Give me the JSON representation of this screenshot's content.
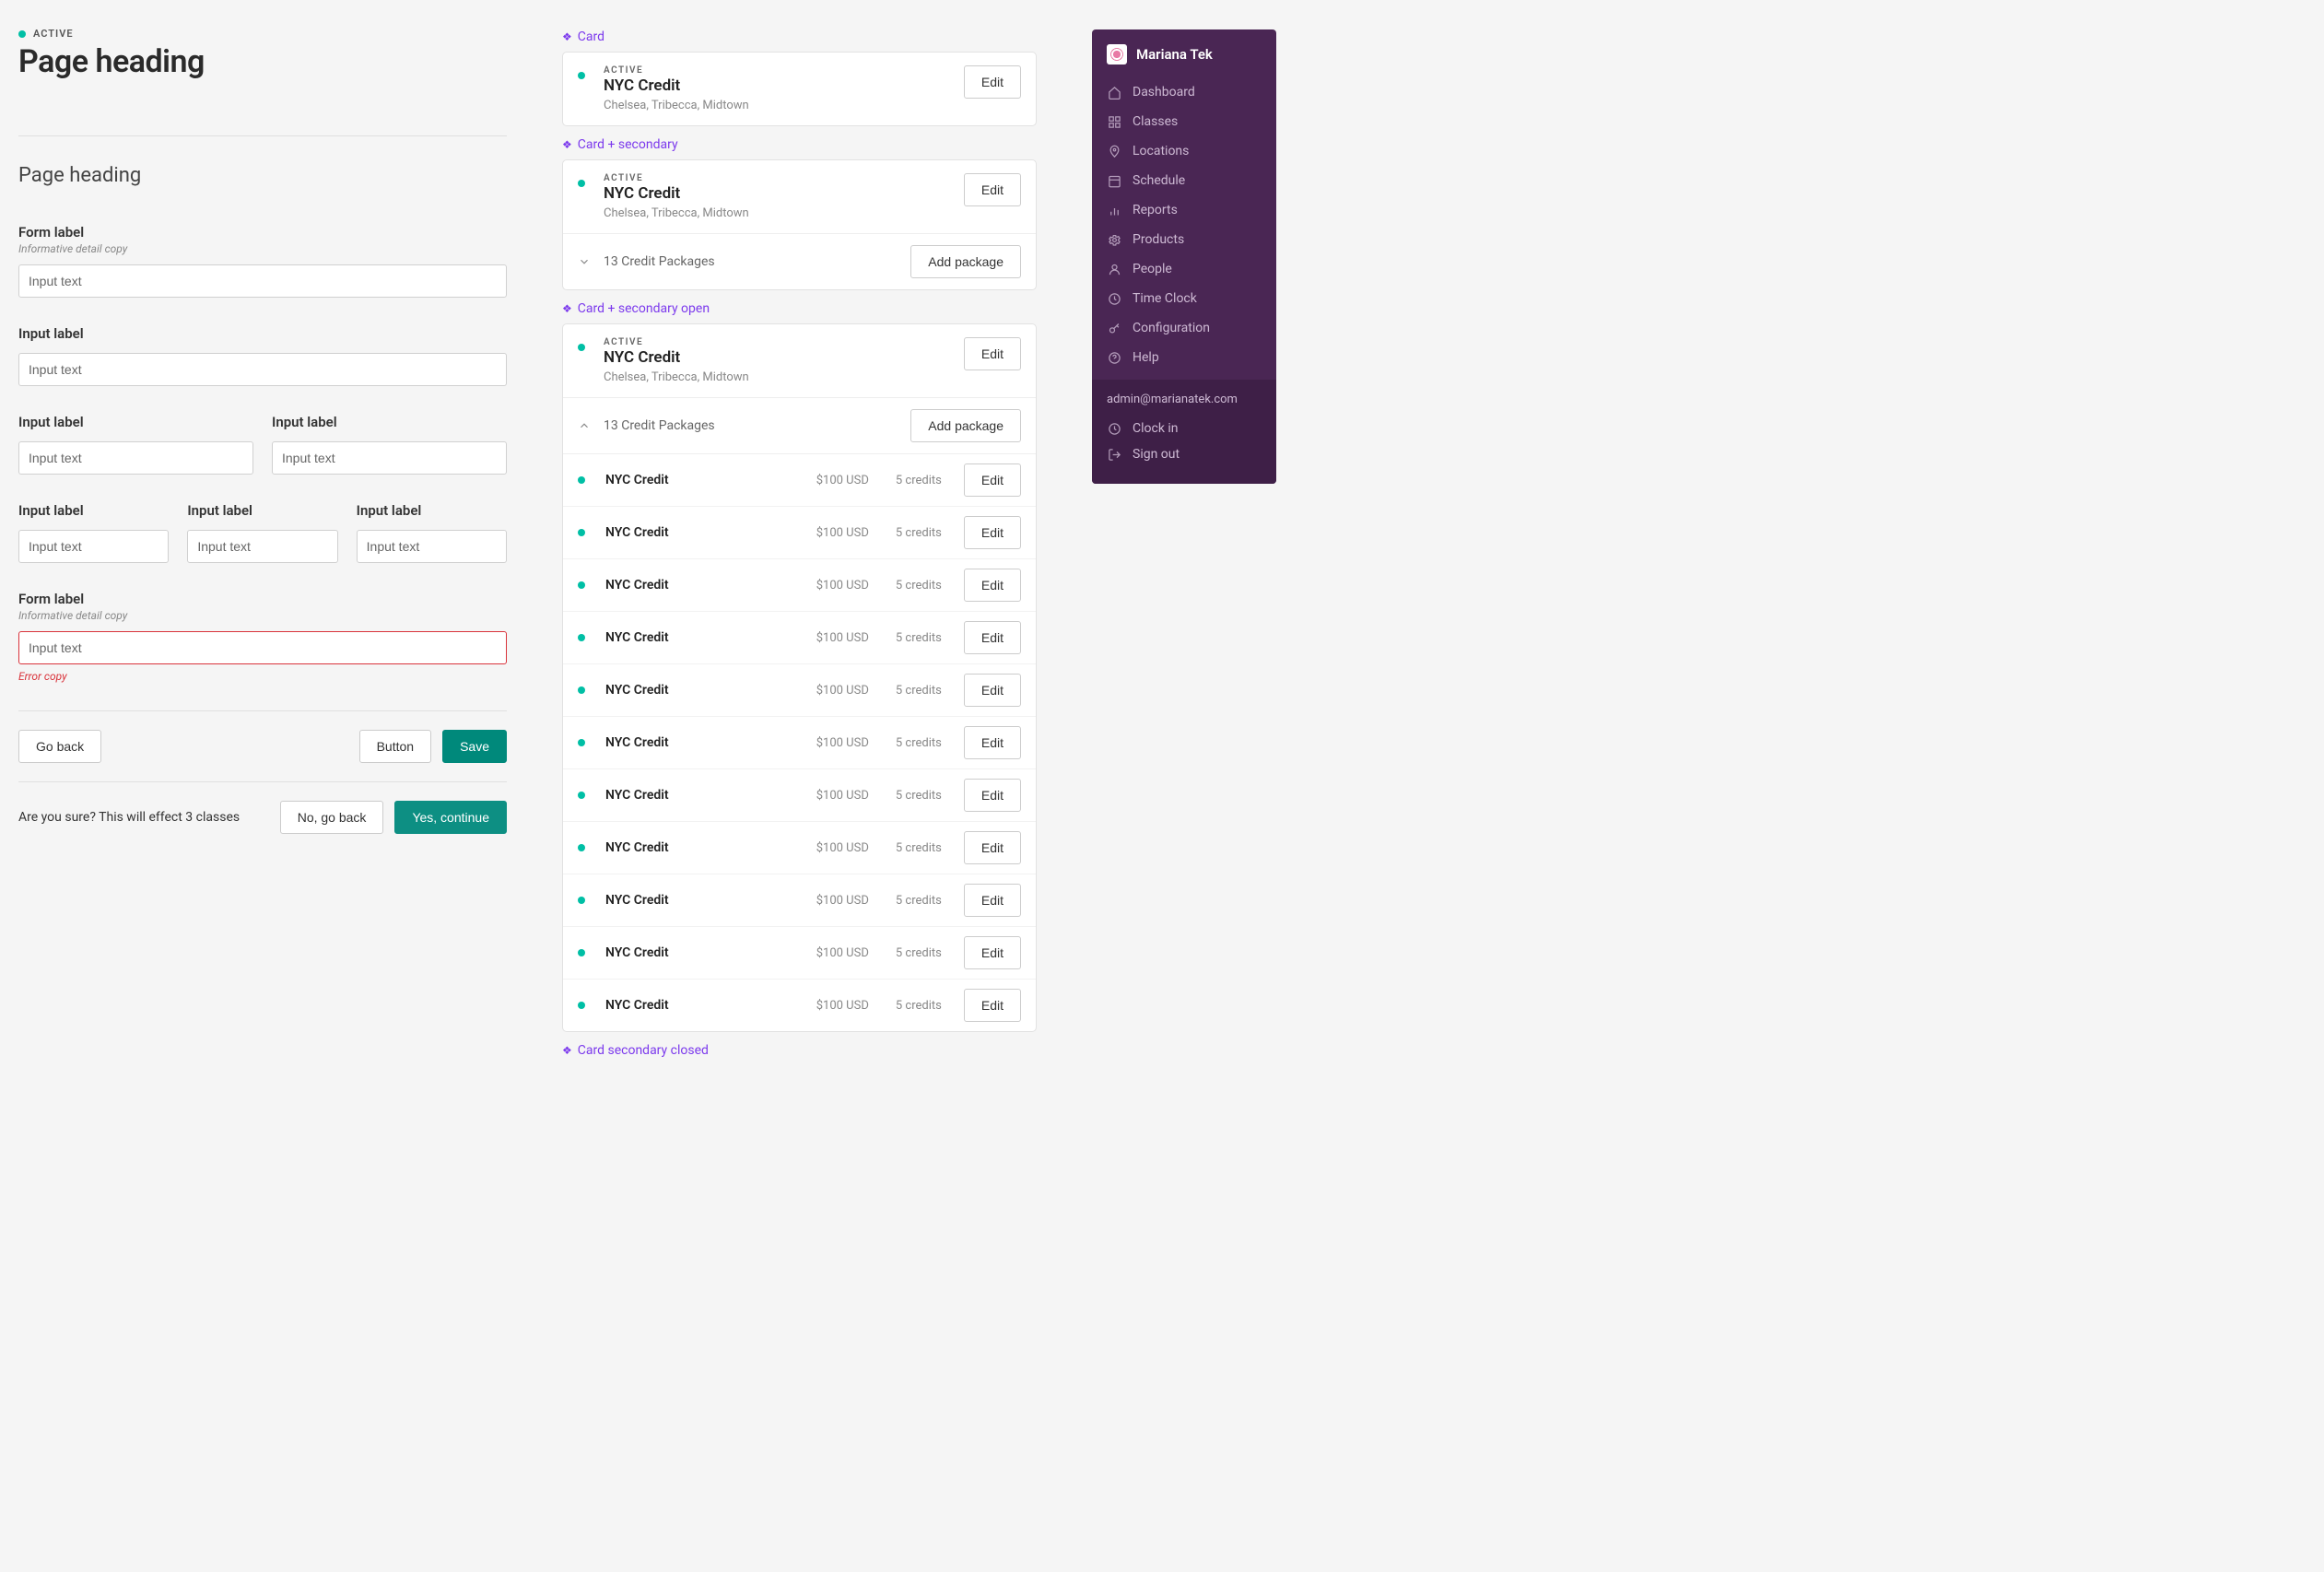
{
  "left": {
    "status": "ACTIVE",
    "h1": "Page heading",
    "h2": "Page heading",
    "form1": {
      "label": "Form label",
      "detail": "Informative detail copy",
      "value": "Input text"
    },
    "single": {
      "label": "Input label",
      "value": "Input text"
    },
    "pair": [
      {
        "label": "Input label",
        "value": "Input text"
      },
      {
        "label": "Input label",
        "value": "Input text"
      }
    ],
    "triple": [
      {
        "label": "Input label",
        "value": "Input text"
      },
      {
        "label": "Input label",
        "value": "Input text"
      },
      {
        "label": "Input label",
        "value": "Input text"
      }
    ],
    "errorField": {
      "label": "Form label",
      "detail": "Informative detail copy",
      "value": "Input text",
      "error": "Error copy"
    },
    "buttons": {
      "back": "Go back",
      "secondary": "Button",
      "primary": "Save"
    },
    "confirm": {
      "text": "Are you sure? This will effect 3 classes",
      "no": "No, go back",
      "yes": "Yes, continue"
    }
  },
  "mid": {
    "labels": {
      "card": "Card",
      "cardSecondary": "Card + secondary",
      "cardSecondaryOpen": "Card + secondary open",
      "cardSecondaryClosed": "Card secondary closed"
    },
    "card": {
      "status": "ACTIVE",
      "title": "NYC Credit",
      "sub": "Chelsea, Tribecca, Midtown",
      "edit": "Edit"
    },
    "secondary": {
      "count": "13 Credit Packages",
      "add": "Add package"
    },
    "packages": [
      {
        "name": "NYC Credit",
        "price": "$100 USD",
        "credits": "5 credits",
        "edit": "Edit"
      },
      {
        "name": "NYC Credit",
        "price": "$100 USD",
        "credits": "5 credits",
        "edit": "Edit"
      },
      {
        "name": "NYC Credit",
        "price": "$100 USD",
        "credits": "5 credits",
        "edit": "Edit"
      },
      {
        "name": "NYC Credit",
        "price": "$100 USD",
        "credits": "5 credits",
        "edit": "Edit"
      },
      {
        "name": "NYC Credit",
        "price": "$100 USD",
        "credits": "5 credits",
        "edit": "Edit"
      },
      {
        "name": "NYC Credit",
        "price": "$100 USD",
        "credits": "5 credits",
        "edit": "Edit"
      },
      {
        "name": "NYC Credit",
        "price": "$100 USD",
        "credits": "5 credits",
        "edit": "Edit"
      },
      {
        "name": "NYC Credit",
        "price": "$100 USD",
        "credits": "5 credits",
        "edit": "Edit"
      },
      {
        "name": "NYC Credit",
        "price": "$100 USD",
        "credits": "5 credits",
        "edit": "Edit"
      },
      {
        "name": "NYC Credit",
        "price": "$100 USD",
        "credits": "5 credits",
        "edit": "Edit"
      },
      {
        "name": "NYC Credit",
        "price": "$100 USD",
        "credits": "5 credits",
        "edit": "Edit"
      }
    ]
  },
  "sidebar": {
    "brand": "Mariana Tek",
    "nav": [
      {
        "icon": "home",
        "label": "Dashboard"
      },
      {
        "icon": "grid",
        "label": "Classes"
      },
      {
        "icon": "pin",
        "label": "Locations"
      },
      {
        "icon": "calendar",
        "label": "Schedule"
      },
      {
        "icon": "bars",
        "label": "Reports"
      },
      {
        "icon": "cog",
        "label": "Products"
      },
      {
        "icon": "user",
        "label": "People"
      },
      {
        "icon": "clock",
        "label": "Time Clock"
      },
      {
        "icon": "key",
        "label": "Configuration"
      },
      {
        "icon": "help",
        "label": "Help"
      }
    ],
    "email": "admin@marianatek.com",
    "footer": [
      {
        "icon": "clock",
        "label": "Clock in"
      },
      {
        "icon": "signout",
        "label": "Sign out"
      }
    ]
  }
}
